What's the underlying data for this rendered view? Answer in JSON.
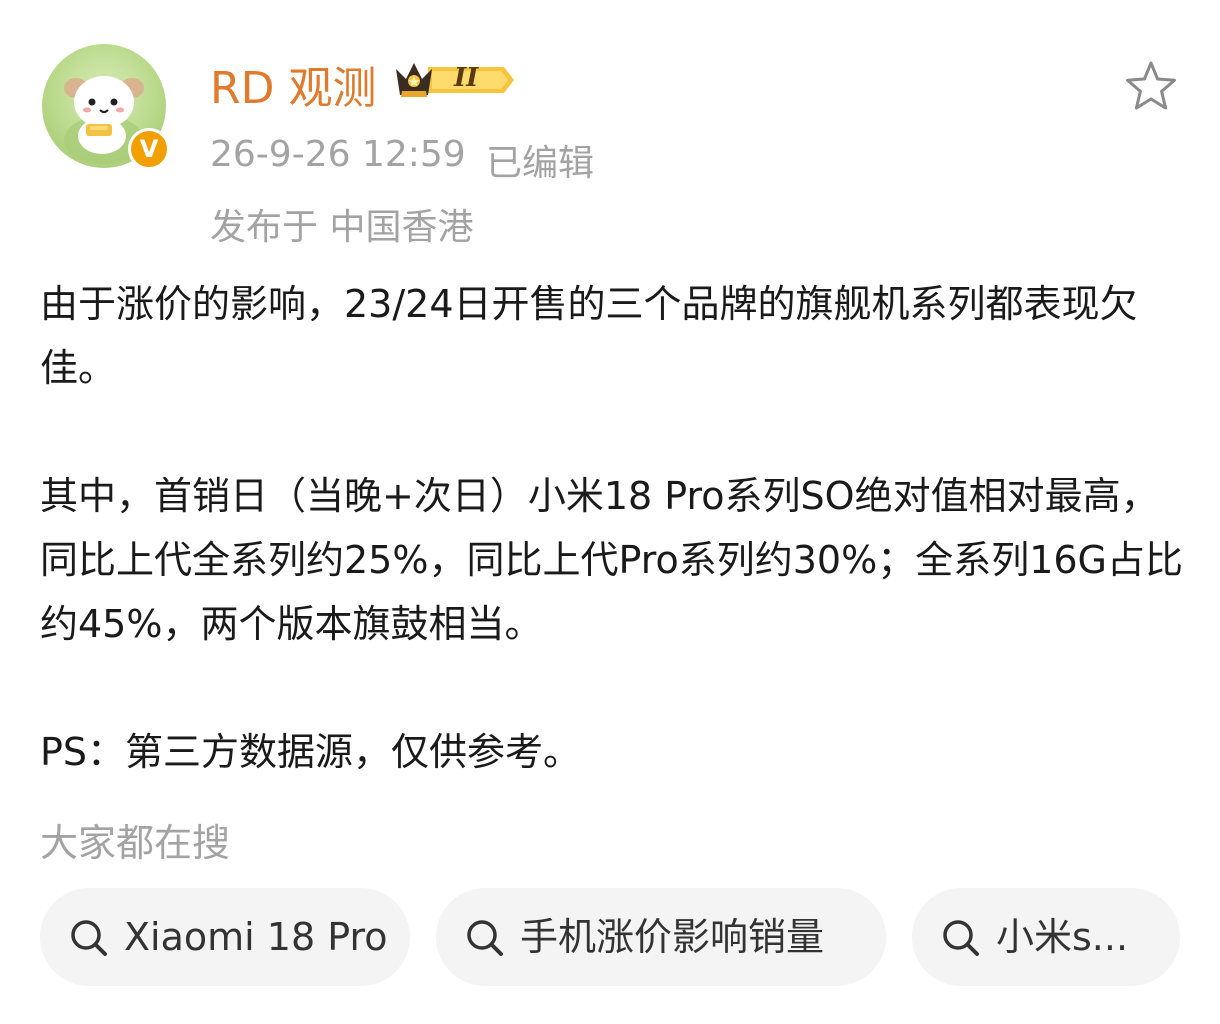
{
  "author": {
    "name": "RD 观测",
    "level_badge": "II",
    "verified_mark": "V",
    "timestamp": "26-9-26 12:59",
    "edited_label": "已编辑",
    "location": "发布于 中国香港"
  },
  "post": {
    "paragraphs": [
      "由于涨价的影响，23/24日开售的三个品牌的旗舰机系列都表现欠佳。",
      "其中，首销日（当晚+次日）小米18 Pro系列SO绝对值相对最高，同比上代全系列约25%，同比上代Pro系列约30%；全系列16G占比约45%，两个版本旗鼓相当。",
      "PS：第三方数据源，仅供参考。"
    ]
  },
  "hot_searches": {
    "title": "大家都在搜",
    "items": [
      {
        "label": "Xiaomi 18 Pro"
      },
      {
        "label": "手机涨价影响销量"
      },
      {
        "label": "小米s..."
      }
    ]
  },
  "icons": {
    "favorite": "star-outline-icon",
    "search": "search-icon",
    "verified": "verified-v-icon",
    "crown": "crown-badge-icon"
  },
  "colors": {
    "username": "#e07a2c",
    "meta_text": "#a3a3a3",
    "body_text": "#1a1a1a",
    "chip_bg": "#f4f4f4",
    "verified_badge": "#f2a000"
  }
}
